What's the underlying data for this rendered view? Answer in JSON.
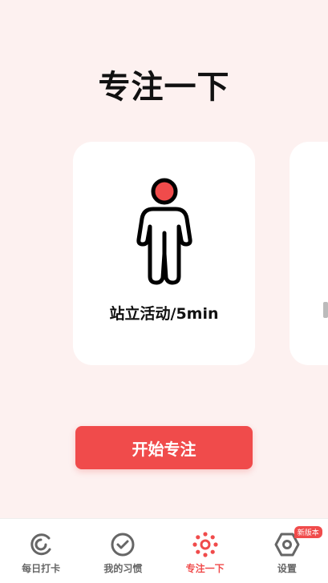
{
  "page": {
    "title": "专注一下"
  },
  "activity_card": {
    "label": "站立活动/5min"
  },
  "start_button": {
    "label": "开始专注"
  },
  "colors": {
    "accent": "#f04b4b",
    "background": "#fdf1f0"
  },
  "tabbar": {
    "tabs": [
      {
        "label": "每日打卡",
        "icon": "daily-checkin-icon",
        "active": false
      },
      {
        "label": "我的习惯",
        "icon": "check-circle-icon",
        "active": false
      },
      {
        "label": "专注一下",
        "icon": "focus-dots-icon",
        "active": true
      },
      {
        "label": "设置",
        "icon": "hexagon-settings-icon",
        "active": false,
        "badge": "新版本"
      }
    ]
  }
}
